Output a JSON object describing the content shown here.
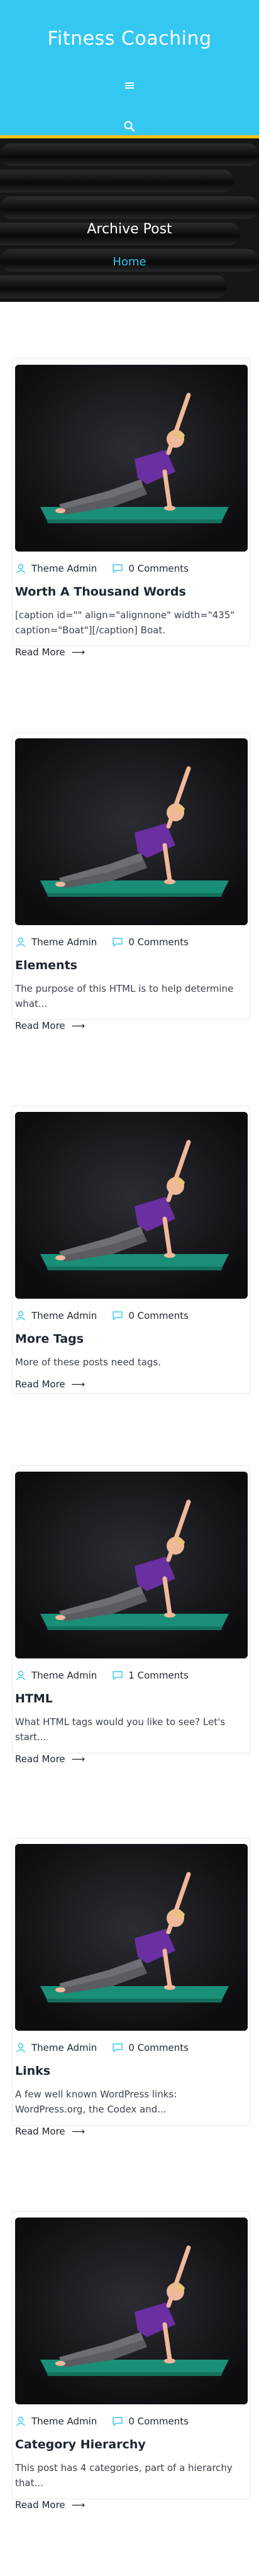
{
  "header": {
    "site_title": "Fitness Coaching",
    "menu_icon": "hamburger-menu-icon",
    "search_icon": "search-icon",
    "accent_color": "#33c7f2",
    "border_color": "#f5c319"
  },
  "banner": {
    "title": "Archive Post",
    "breadcrumb": "Home"
  },
  "posts": [
    {
      "author": "Theme Admin",
      "comments": "0 Comments",
      "title": "Worth A Thousand Words",
      "excerpt_lines": [
        "[caption id=\"\" align=\"alignnone\" width=\"435\"",
        "caption=\"Boat\"][/caption] Boat."
      ],
      "read_more": "Read More"
    },
    {
      "author": "Theme Admin",
      "comments": "0 Comments",
      "title": "Elements",
      "excerpt_lines": [
        "The purpose of this HTML is to help determine",
        "what..."
      ],
      "read_more": "Read More"
    },
    {
      "author": "Theme Admin",
      "comments": "0 Comments",
      "title": "More Tags",
      "excerpt_lines": [
        "More of these posts need tags."
      ],
      "read_more": "Read More"
    },
    {
      "author": "Theme Admin",
      "comments": "1 Comments",
      "title": "HTML",
      "excerpt_lines": [
        "What HTML tags would you like to see? Let's",
        "start..."
      ],
      "read_more": "Read More"
    },
    {
      "author": "Theme Admin",
      "comments": "0 Comments",
      "title": "Links",
      "excerpt_lines": [
        "A few well known WordPress links:",
        "WordPress.org, the Codex and..."
      ],
      "read_more": "Read More"
    },
    {
      "author": "Theme Admin",
      "comments": "0 Comments",
      "title": "Category Hierarchy",
      "excerpt_lines": [
        "This post has 4 categories, part of a hierarchy",
        "that..."
      ],
      "read_more": "Read More"
    }
  ]
}
